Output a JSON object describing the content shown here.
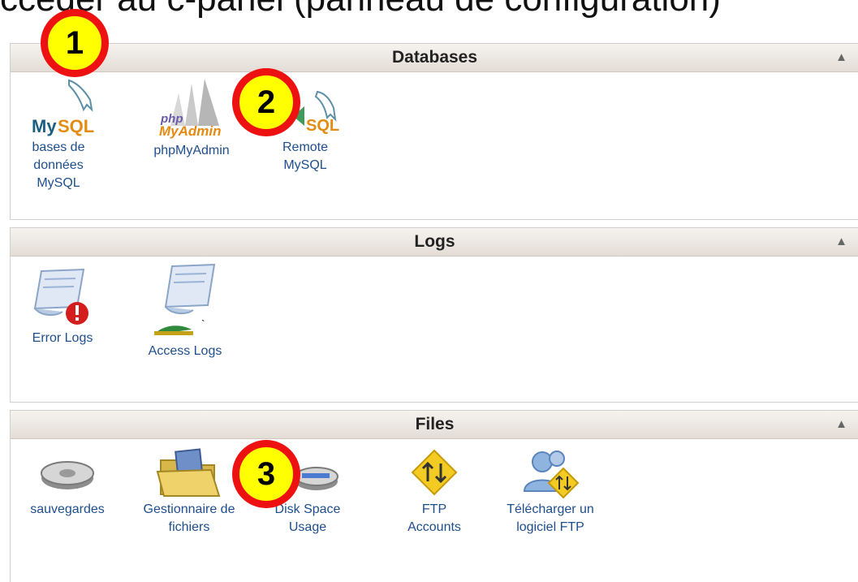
{
  "page": {
    "heading": "cceder au c-panel (panneau de configuration)"
  },
  "panels": [
    {
      "title": "Databases",
      "items": [
        {
          "label": "bases de données MySQL",
          "icon": "mysql-icon"
        },
        {
          "label": "phpMyAdmin",
          "icon": "phpmyadmin-icon"
        },
        {
          "label": "Remote MySQL",
          "icon": "remote-mysql-icon"
        }
      ]
    },
    {
      "title": "Logs",
      "items": [
        {
          "label": "Error Logs",
          "icon": "error-logs-icon"
        },
        {
          "label": "Access Logs",
          "icon": "access-logs-icon"
        }
      ]
    },
    {
      "title": "Files",
      "items": [
        {
          "label": "sauvegardes",
          "icon": "backup-disk-icon"
        },
        {
          "label": "Gestionnaire de fichiers",
          "icon": "file-manager-folder-icon"
        },
        {
          "label": "Disk Space Usage",
          "icon": "disk-space-icon"
        },
        {
          "label": "FTP Accounts",
          "icon": "ftp-accounts-icon"
        },
        {
          "label": "Télécharger un logiciel FTP",
          "icon": "ftp-software-download-icon"
        }
      ]
    }
  ],
  "badges": [
    "1",
    "2",
    "3"
  ],
  "colors": {
    "link": "#1e4e8c",
    "header_bg": "#e9e4de",
    "badge_fill": "#ffff00",
    "badge_ring": "#ee1111"
  }
}
